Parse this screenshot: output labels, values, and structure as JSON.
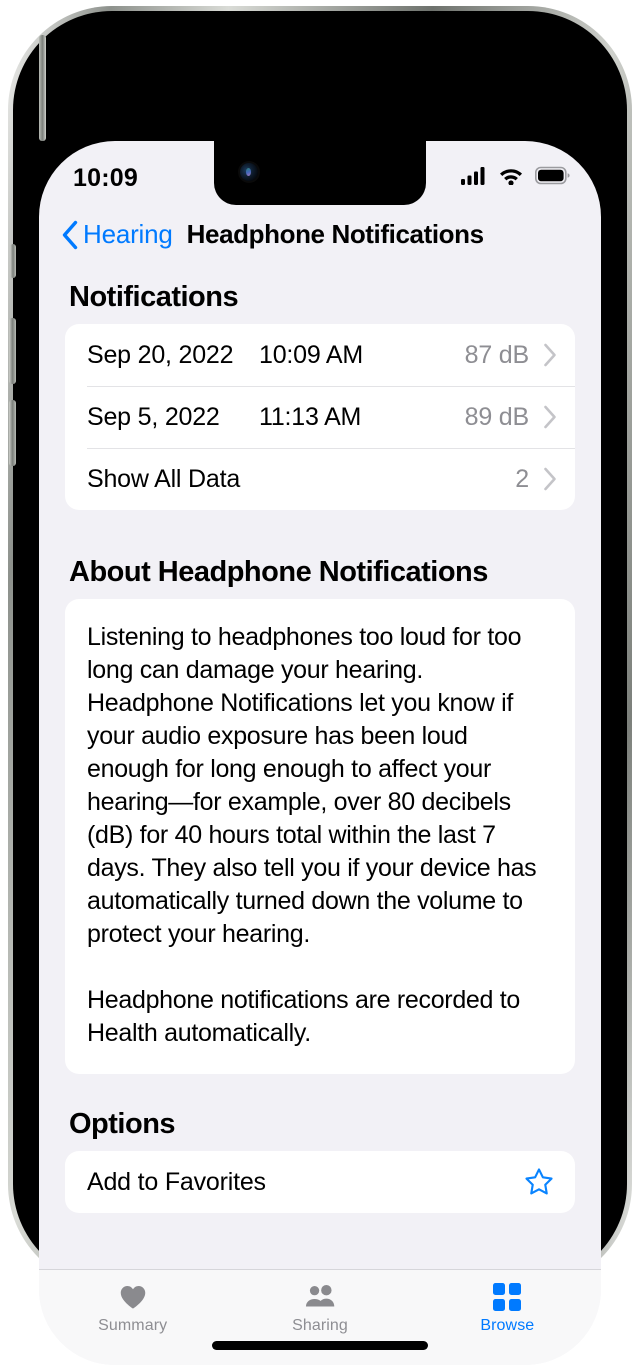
{
  "status_bar": {
    "time": "10:09",
    "cellular_icon": "cellular-signal-icon",
    "wifi_icon": "wifi-icon",
    "battery_icon": "battery-full-icon"
  },
  "nav_bar": {
    "back_label": "Hearing",
    "back_icon": "chevron-left-icon",
    "title": "Headphone Notifications"
  },
  "notifications": {
    "header": "Notifications",
    "rows": [
      {
        "date": "Sep 20, 2022",
        "time": "10:09 AM",
        "value": "87 dB",
        "chevron": "chevron-right-icon"
      },
      {
        "date": "Sep 5, 2022",
        "time": "11:13 AM",
        "value": "89 dB",
        "chevron": "chevron-right-icon"
      }
    ],
    "show_all": {
      "label": "Show All Data",
      "value": "2",
      "chevron": "chevron-right-icon"
    }
  },
  "about": {
    "header": "About Headphone Notifications",
    "paragraph1": "Listening to headphones too loud for too long can damage your hearing. Headphone Notifications let you know if your audio exposure has been loud enough for long enough to affect your hearing—for example, over 80 decibels (dB) for 40 hours total within the last 7 days. They also tell you if your device has automatically turned down the volume to protect your hearing.",
    "paragraph2": "Headphone notifications are recorded to Health automatically."
  },
  "options": {
    "header": "Options",
    "add_to_favorites": {
      "label": "Add to Favorites",
      "icon": "star-outline-icon"
    }
  },
  "tab_bar": {
    "tabs": [
      {
        "label": "Summary",
        "icon": "heart-icon",
        "active": false
      },
      {
        "label": "Sharing",
        "icon": "two-people-icon",
        "active": false
      },
      {
        "label": "Browse",
        "icon": "grid-squares-icon",
        "active": true
      }
    ]
  },
  "colors": {
    "accent": "#007aff",
    "background": "#f2f1f6",
    "card": "#ffffff",
    "secondary_text": "#8e8e93"
  }
}
